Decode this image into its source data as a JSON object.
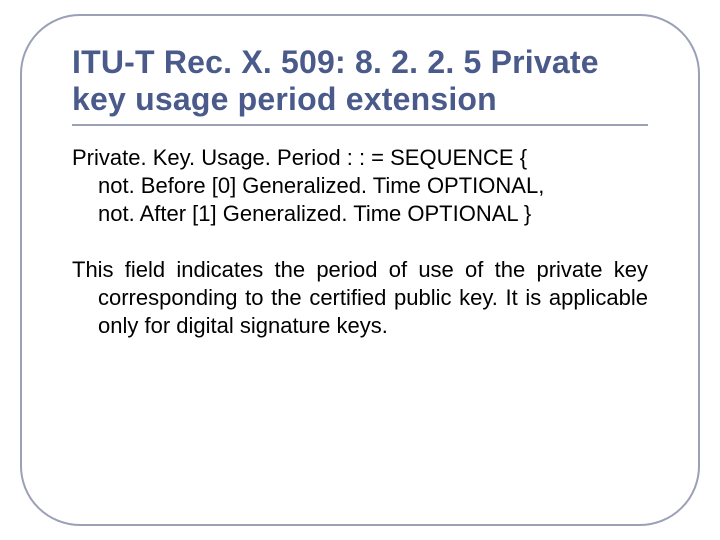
{
  "slide": {
    "title": "ITU-T Rec. X. 509: 8. 2. 2. 5 Private key usage period extension",
    "code": {
      "l1": "Private. Key. Usage. Period  : : =  SEQUENCE {",
      "l2": "not. Before [0] Generalized. Time OPTIONAL,",
      "l3": "not. After [1] Generalized. Time OPTIONAL }"
    },
    "description": "This field indicates the period of use of the private key corresponding to the certified public key. It is applicable only for digital signature keys."
  }
}
